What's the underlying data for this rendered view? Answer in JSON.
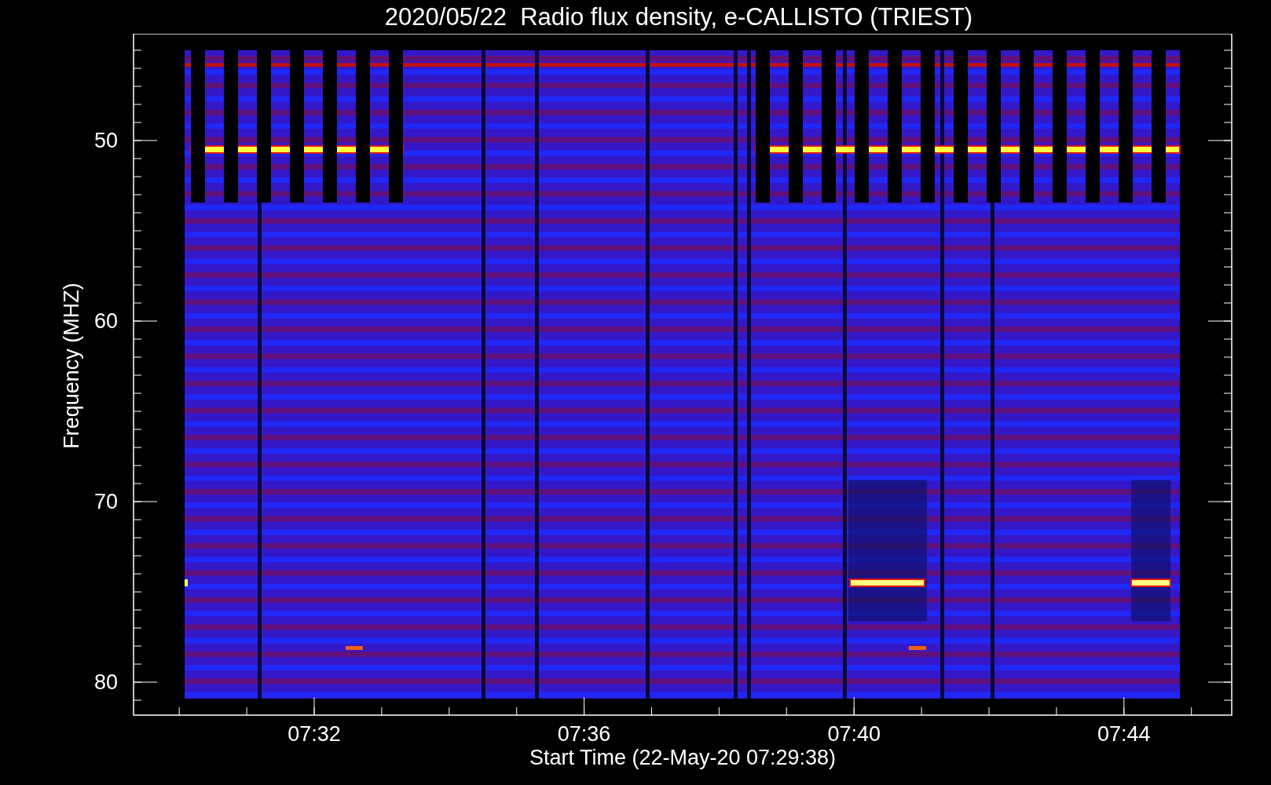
{
  "title": "2020/05/22  Radio flux density, e-CALLISTO (TRIEST)",
  "plot": {
    "ylabel": "Frequency (MHZ)",
    "xlabel": "Start Time (22-May-20 07:29:38)",
    "yticks": [
      "50",
      "60",
      "70",
      "80"
    ],
    "xticks": [
      "07:32",
      "07:36",
      "07:40",
      "07:44"
    ]
  }
}
